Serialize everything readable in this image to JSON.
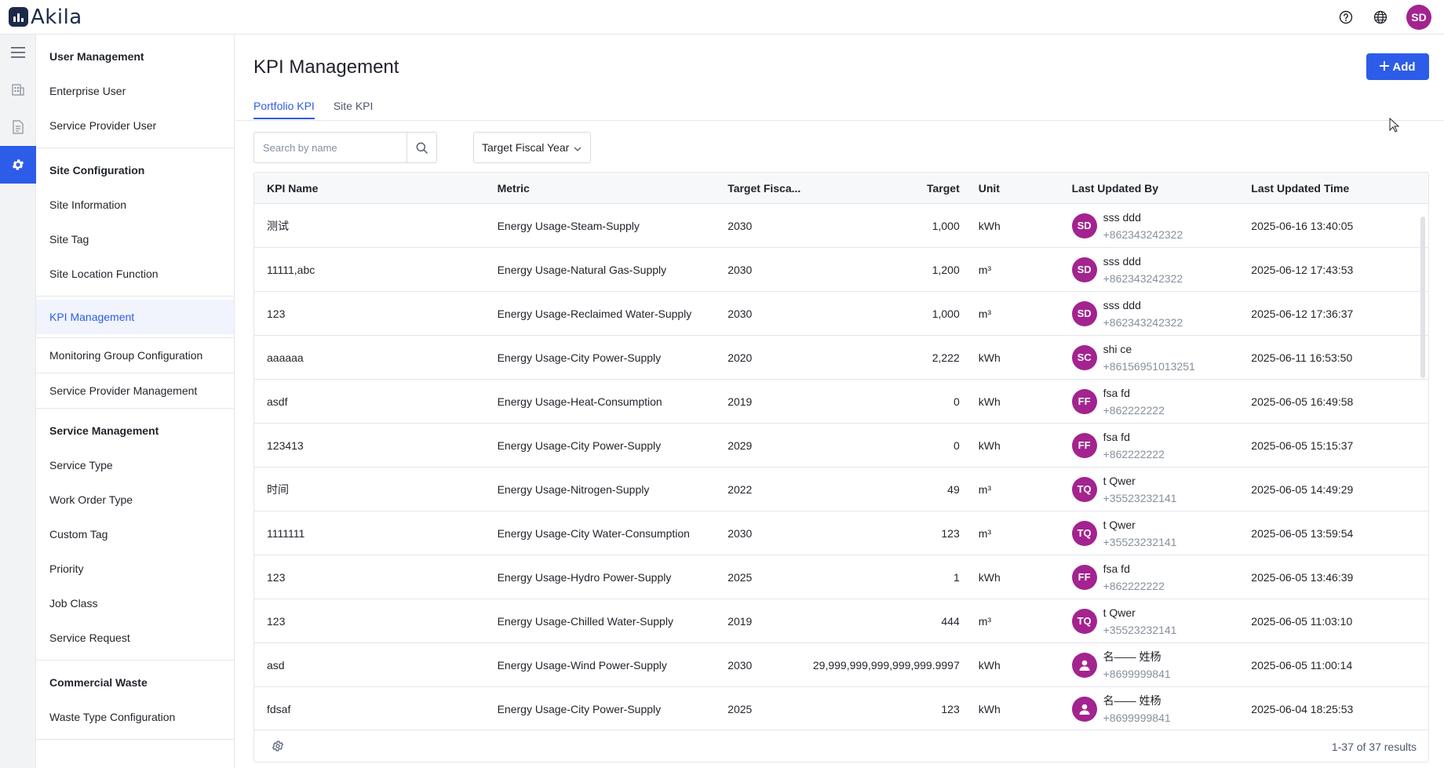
{
  "app": {
    "name": "Akila"
  },
  "user": {
    "initials": "SD"
  },
  "icons": {
    "help": "help-circle-icon",
    "language": "globe-icon",
    "menu": "hamburger-menu-icon",
    "building": "building-icon",
    "document": "document-icon",
    "settings": "gear-icon"
  },
  "colors": {
    "accent": "#2c5ce8",
    "avatar": "#a3238f",
    "active_bg": "#f1f4fd"
  },
  "sidebar": {
    "groups": [
      {
        "title": "User Management",
        "items": [
          "Enterprise User",
          "Service Provider User"
        ]
      },
      {
        "title": "Site Configuration",
        "items": [
          "Site Information",
          "Site Tag",
          "Site Location Function"
        ]
      },
      {
        "title": "",
        "items": [
          "KPI Management"
        ]
      },
      {
        "title": "",
        "items": [
          "Monitoring Group Configuration"
        ]
      },
      {
        "title": "",
        "items": [
          "Service Provider Management"
        ]
      },
      {
        "title": "Service Management",
        "items": [
          "Service Type",
          "Work Order Type",
          "Custom Tag",
          "Priority",
          "Job Class",
          "Service Request"
        ]
      },
      {
        "title": "Commercial Waste",
        "items": [
          "Waste Type Configuration"
        ]
      }
    ],
    "active_item": "KPI Management"
  },
  "page": {
    "title": "KPI Management",
    "add_label": "Add",
    "tabs": [
      {
        "label": "Portfolio KPI",
        "active": true
      },
      {
        "label": "Site KPI",
        "active": false
      }
    ],
    "search_placeholder": "Search by name",
    "filter_label": "Target Fiscal Year"
  },
  "table": {
    "columns": [
      "KPI Name",
      "Metric",
      "Target Fisca...",
      "Target",
      "Unit",
      "Last Updated By",
      "Last Updated Time"
    ],
    "rows": [
      {
        "name": "测试",
        "metric": "Energy Usage-Steam-Supply",
        "year": "2030",
        "target": "1,000",
        "unit": "kWh",
        "avatar": "SD",
        "user": "sss ddd",
        "phone": "+862343242322",
        "time": "2025-06-16 13:40:05"
      },
      {
        "name": "11111,abc",
        "metric": "Energy Usage-Natural Gas-Supply",
        "year": "2030",
        "target": "1,200",
        "unit": "m³",
        "avatar": "SD",
        "user": "sss ddd",
        "phone": "+862343242322",
        "time": "2025-06-12 17:43:53"
      },
      {
        "name": "123",
        "metric": "Energy Usage-Reclaimed Water-Supply",
        "year": "2030",
        "target": "1,000",
        "unit": "m³",
        "avatar": "SD",
        "user": "sss ddd",
        "phone": "+862343242322",
        "time": "2025-06-12 17:36:37"
      },
      {
        "name": "aaaaaa",
        "metric": "Energy Usage-City Power-Supply",
        "year": "2020",
        "target": "2,222",
        "unit": "kWh",
        "avatar": "SC",
        "user": "shi ce",
        "phone": "+86156951013251",
        "time": "2025-06-11 16:53:50"
      },
      {
        "name": "asdf",
        "metric": "Energy Usage-Heat-Consumption",
        "year": "2019",
        "target": "0",
        "unit": "kWh",
        "avatar": "FF",
        "user": "fsa fd",
        "phone": "+862222222",
        "time": "2025-06-05 16:49:58"
      },
      {
        "name": "123413",
        "metric": "Energy Usage-City Power-Supply",
        "year": "2029",
        "target": "0",
        "unit": "kWh",
        "avatar": "FF",
        "user": "fsa fd",
        "phone": "+862222222",
        "time": "2025-06-05 15:15:37"
      },
      {
        "name": "时间",
        "metric": "Energy Usage-Nitrogen-Supply",
        "year": "2022",
        "target": "49",
        "unit": "m³",
        "avatar": "TQ",
        "user": "t Qwer",
        "phone": "+35523232141",
        "time": "2025-06-05 14:49:29"
      },
      {
        "name": "1111111",
        "metric": "Energy Usage-City Water-Consumption",
        "year": "2030",
        "target": "123",
        "unit": "m³",
        "avatar": "TQ",
        "user": "t Qwer",
        "phone": "+35523232141",
        "time": "2025-06-05 13:59:54"
      },
      {
        "name": "123",
        "metric": "Energy Usage-Hydro Power-Supply",
        "year": "2025",
        "target": "1",
        "unit": "kWh",
        "avatar": "FF",
        "user": "fsa fd",
        "phone": "+862222222",
        "time": "2025-06-05 13:46:39"
      },
      {
        "name": "123",
        "metric": "Energy Usage-Chilled Water-Supply",
        "year": "2019",
        "target": "444",
        "unit": "m³",
        "avatar": "TQ",
        "user": "t Qwer",
        "phone": "+35523232141",
        "time": "2025-06-05 11:03:10"
      },
      {
        "name": "asd",
        "metric": "Energy Usage-Wind Power-Supply",
        "year": "2030",
        "target": "29,999,999,999,999,999.9997",
        "unit": "kWh",
        "avatar": "",
        "user": "名—— 姓杨",
        "phone": "+8699999841",
        "time": "2025-06-05 11:00:14"
      },
      {
        "name": "fdsaf",
        "metric": "Energy Usage-City Power-Supply",
        "year": "2025",
        "target": "123",
        "unit": "kWh",
        "avatar": "",
        "user": "名—— 姓杨",
        "phone": "+8699999841",
        "time": "2025-06-04 18:25:53"
      }
    ],
    "footer_results": "1-37 of 37 results"
  }
}
